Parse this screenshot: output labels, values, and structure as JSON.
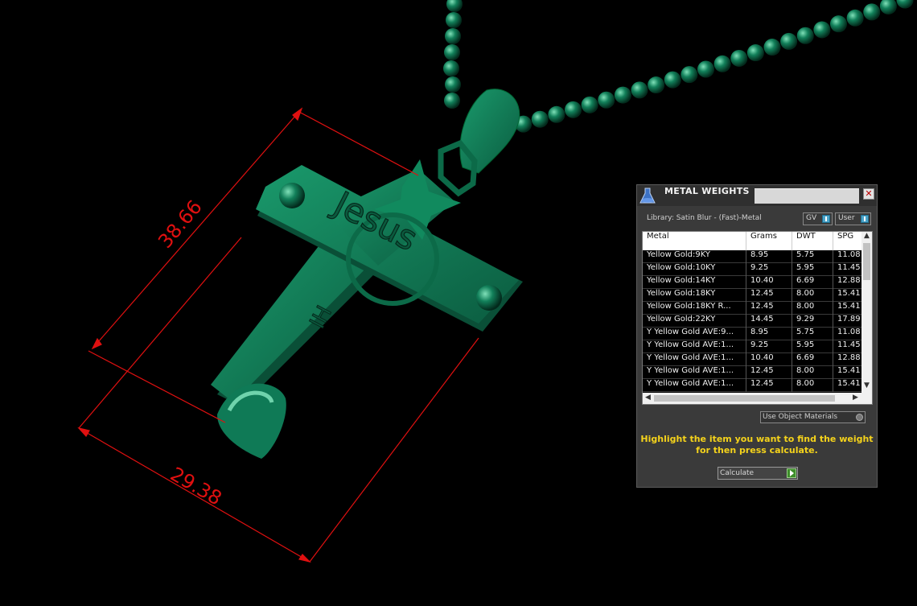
{
  "viewport": {
    "dimension_height": "38.66",
    "dimension_width": "29.38",
    "engraving_text": "Jesus",
    "dimension_color": "#e01010",
    "model_color": "#0f7a56"
  },
  "panel": {
    "title": "METAL WEIGHTS",
    "close_glyph": "✕",
    "library_label": "Library: Satin Blur - (Fast)-Metal",
    "gv_label": "GV",
    "user_label": "User",
    "columns": [
      "Metal",
      "Grams",
      "DWT",
      "SPG"
    ],
    "rows": [
      [
        "Yellow Gold:9KY",
        "8.95",
        "5.75",
        "11.08"
      ],
      [
        "Yellow Gold:10KY",
        "9.25",
        "5.95",
        "11.45"
      ],
      [
        "Yellow Gold:14KY",
        "10.40",
        "6.69",
        "12.88"
      ],
      [
        "Yellow Gold:18KY",
        "12.45",
        "8.00",
        "15.41"
      ],
      [
        "Yellow Gold:18KY R...",
        "12.45",
        "8.00",
        "15.41"
      ],
      [
        "Yellow Gold:22KY",
        "14.45",
        "9.29",
        "17.89"
      ],
      [
        "Y Yellow Gold AVE:9...",
        "8.95",
        "5.75",
        "11.08"
      ],
      [
        "Y Yellow Gold AVE:1...",
        "9.25",
        "5.95",
        "11.45"
      ],
      [
        "Y Yellow Gold AVE:1...",
        "10.40",
        "6.69",
        "12.88"
      ],
      [
        "Y Yellow Gold AVE:1...",
        "12.45",
        "8.00",
        "15.41"
      ],
      [
        "Y Yellow Gold AVE:1...",
        "12.45",
        "8.00",
        "15.41"
      ]
    ],
    "scroll_up": "▲",
    "scroll_down": "▼",
    "scroll_left": "◀",
    "scroll_right": "▶",
    "use_object_materials": "Use Object Materials",
    "hint_line1": "Highlight the item you want to find the weight",
    "hint_line2": "for then press calculate.",
    "calculate_label": "Calculate",
    "accent_color": "#f5d31b"
  }
}
